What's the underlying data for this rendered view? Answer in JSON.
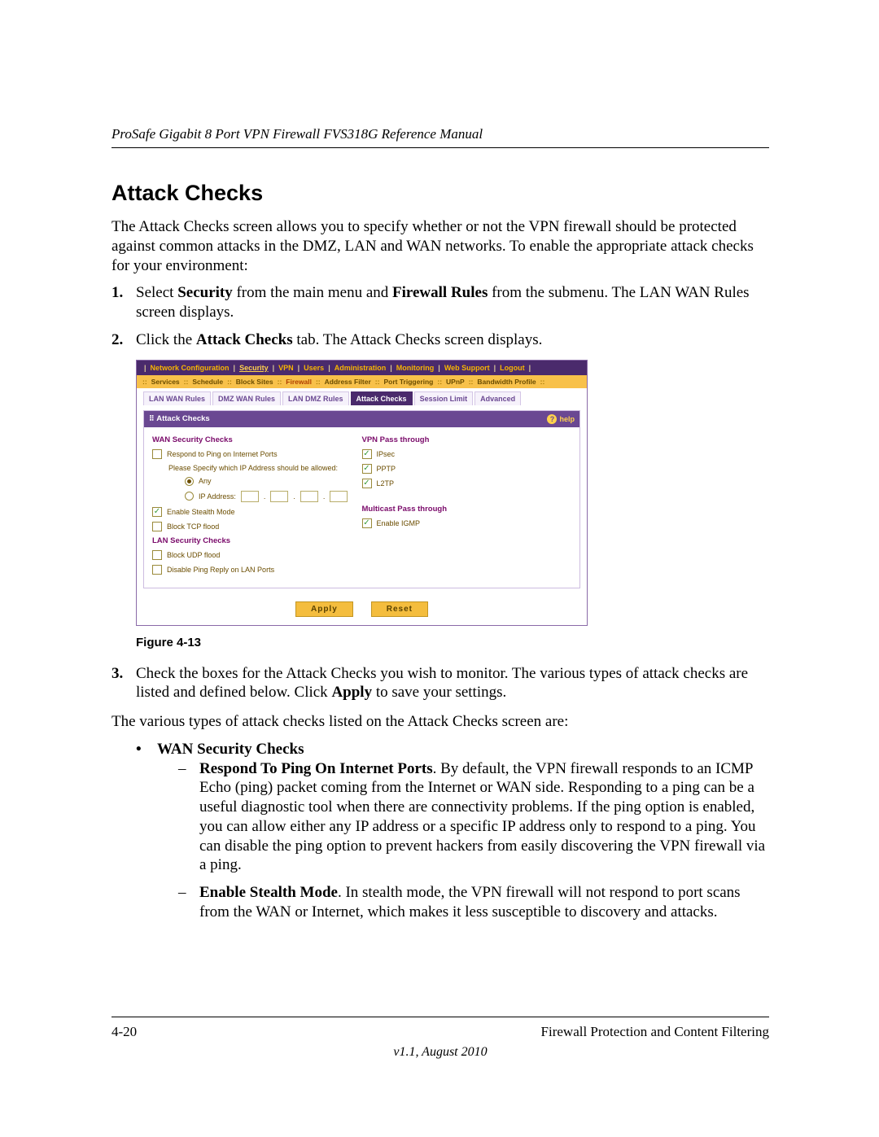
{
  "doc": {
    "running_header": "ProSafe Gigabit 8 Port VPN Firewall FVS318G Reference Manual",
    "section_title": "Attack Checks",
    "intro_text": "The Attack Checks screen allows you to specify whether or not the VPN firewall should be protected against common attacks in the DMZ, LAN and WAN networks. To enable the appropriate attack checks for your environment:",
    "step1_num": "1.",
    "step1_prefix": "Select ",
    "step1_bold1": "Security",
    "step1_mid": " from the main menu and ",
    "step1_bold2": "Firewall Rules",
    "step1_suffix": " from the submenu. The LAN WAN Rules screen displays.",
    "step2_num": "2.",
    "step2_prefix": "Click the ",
    "step2_bold": "Attack Checks",
    "step2_suffix": " tab. The Attack Checks screen displays.",
    "figure_label": "Figure 4-13",
    "step3_num": "3.",
    "step3_prefix": "Check the boxes for the Attack Checks you wish to monitor. The various types of attack checks are listed and defined below. Click ",
    "step3_bold": "Apply",
    "step3_suffix": " to save your settings.",
    "summary_line": "The various types of attack checks listed on the Attack Checks screen are:",
    "bullet_mark": "•",
    "dash_mark": "–",
    "bullet1_title": "WAN Security Checks",
    "sub1_title": "Respond To Ping On Internet Ports",
    "sub1_body": ". By default, the VPN firewall responds to an ICMP Echo (ping) packet coming from the Internet or WAN side. Responding to a ping can be a useful diagnostic tool when there are connectivity problems. If the ping option is enabled, you can allow either any IP address or a specific IP address only to respond to a ping. You can disable the ping option to prevent hackers from easily discovering the VPN firewall via a ping.",
    "sub2_title": "Enable Stealth Mode",
    "sub2_body": ". In stealth mode, the VPN firewall will not respond to port scans from the WAN or Internet, which makes it less susceptible to discovery and attacks.",
    "footer_page": "4-20",
    "footer_chapter": "Firewall Protection and Content Filtering",
    "footer_version": "v1.1, August 2010"
  },
  "ui": {
    "topnav": [
      "Network Configuration",
      "Security",
      "VPN",
      "Users",
      "Administration",
      "Monitoring",
      "Web Support",
      "Logout"
    ],
    "topnav_active": "Security",
    "subnav": [
      "Services",
      "Schedule",
      "Block Sites",
      "Firewall",
      "Address Filter",
      "Port Triggering",
      "UPnP",
      "Bandwidth Profile"
    ],
    "subnav_active": "Firewall",
    "tabs": [
      "LAN WAN Rules",
      "DMZ WAN Rules",
      "LAN DMZ Rules",
      "Attack Checks",
      "Session Limit",
      "Advanced"
    ],
    "tabs_active": "Attack Checks",
    "panel_title": "Attack Checks",
    "help_label": "help",
    "wan_title": "WAN Security Checks",
    "wan_ping": "Respond to Ping on Internet Ports",
    "wan_specify": "Please Specify which IP Address should be allowed:",
    "wan_any": "Any",
    "wan_ipaddr": "IP Address:",
    "wan_stealth": "Enable Stealth Mode",
    "wan_tcp": "Block TCP flood",
    "lan_title": "LAN Security Checks",
    "lan_udp": "Block UDP flood",
    "lan_pingreply": "Disable Ping Reply on LAN Ports",
    "vpn_title": "VPN Pass through",
    "vpn_ipsec": "IPsec",
    "vpn_pptp": "PPTP",
    "vpn_l2tp": "L2TP",
    "multi_title": "Multicast Pass through",
    "multi_igmp": "Enable IGMP",
    "btn_apply": "Apply",
    "btn_reset": "Reset"
  }
}
